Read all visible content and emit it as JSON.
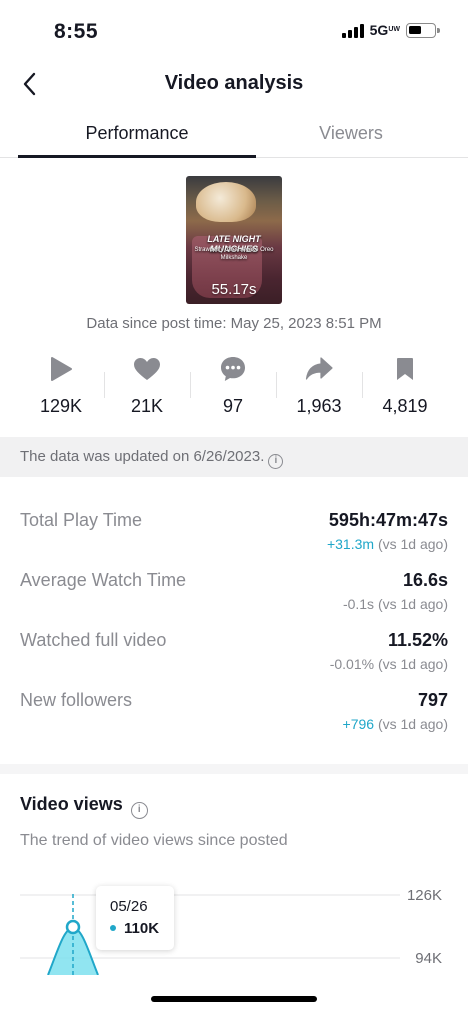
{
  "status_bar": {
    "time": "8:55",
    "network": "5G",
    "network_sup": "UW"
  },
  "nav": {
    "title": "Video analysis",
    "back_icon": "chevron-left-icon"
  },
  "tabs": [
    {
      "label": "Performance",
      "active": true
    },
    {
      "label": "Viewers",
      "active": false
    }
  ],
  "video": {
    "duration": "55.17s",
    "overlay_title": "LATE NIGHT MUNCHIES",
    "overlay_subtitle": "Strawberry Cheesecake Oreo Milkshake"
  },
  "data_since": "Data since post time: May 25, 2023 8:51 PM",
  "stats": [
    {
      "icon": "play-icon",
      "value": "129K"
    },
    {
      "icon": "heart-icon",
      "value": "21K"
    },
    {
      "icon": "comment-icon",
      "value": "97"
    },
    {
      "icon": "share-icon",
      "value": "1,963"
    },
    {
      "icon": "bookmark-icon",
      "value": "4,819"
    }
  ],
  "update_notice": "The data was updated on 6/26/2023.",
  "metrics": [
    {
      "label": "Total Play Time",
      "value": "595h:47m:47s",
      "delta": "+31.3m",
      "delta_suffix": "(vs 1d ago)",
      "trend": "up"
    },
    {
      "label": "Average Watch Time",
      "value": "16.6s",
      "delta": "-0.1s",
      "delta_suffix": "(vs 1d ago)",
      "trend": "down"
    },
    {
      "label": "Watched full video",
      "value": "11.52%",
      "delta": "-0.01%",
      "delta_suffix": "(vs 1d ago)",
      "trend": "down"
    },
    {
      "label": "New followers",
      "value": "797",
      "delta": "+796",
      "delta_suffix": "(vs 1d ago)",
      "trend": "up"
    }
  ],
  "video_views": {
    "title": "Video views",
    "subtitle": "The trend of video views since posted",
    "tooltip": {
      "date": "05/26",
      "value": "110K"
    }
  },
  "colors": {
    "accent": "#20a7c9",
    "text": "#161823",
    "muted": "#8a8b91"
  },
  "chart_data": {
    "type": "area",
    "x": [
      "05/26"
    ],
    "series": [
      {
        "values": [
          110000
        ]
      }
    ],
    "y_ticks": [
      "126K",
      "94K"
    ]
  }
}
